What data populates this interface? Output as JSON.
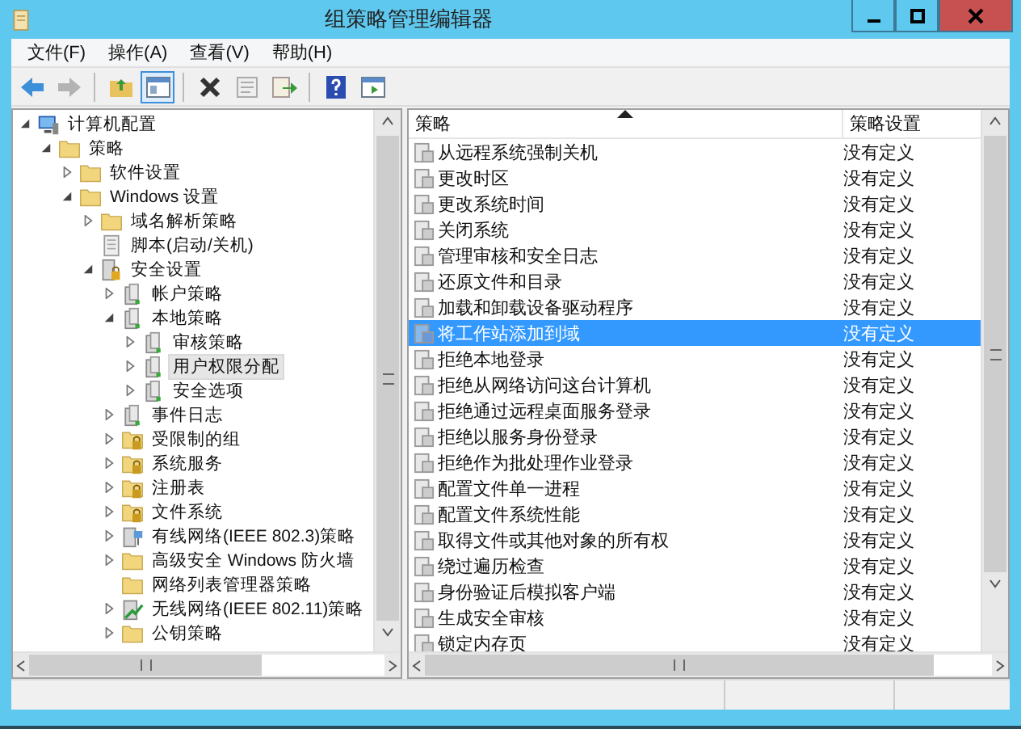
{
  "window": {
    "title": "组策略管理编辑器"
  },
  "menu": [
    "文件(F)",
    "操作(A)",
    "查看(V)",
    "帮助(H)"
  ],
  "toolbar": [
    [
      {
        "kind": "back",
        "disabled": false,
        "pressed": false
      },
      {
        "kind": "forward",
        "disabled": true,
        "pressed": false
      }
    ],
    [
      {
        "kind": "up",
        "disabled": false,
        "pressed": false
      },
      {
        "kind": "tree",
        "disabled": false,
        "pressed": true
      }
    ],
    [
      {
        "kind": "delete",
        "disabled": false,
        "pressed": false
      },
      {
        "kind": "properties",
        "disabled": true,
        "pressed": false
      },
      {
        "kind": "export",
        "disabled": false,
        "pressed": false
      }
    ],
    [
      {
        "kind": "help",
        "disabled": false,
        "pressed": false
      },
      {
        "kind": "pane",
        "disabled": false,
        "pressed": false
      }
    ]
  ],
  "tree": [
    {
      "label": "计算机配置",
      "kind": "computer",
      "expanded": true,
      "selected": false,
      "children": [
        {
          "label": "策略",
          "kind": "folder",
          "expanded": true,
          "selected": false,
          "children": [
            {
              "label": "软件设置",
              "kind": "folder",
              "expanded": false,
              "selected": false
            },
            {
              "label": "Windows 设置",
              "kind": "folder",
              "expanded": true,
              "selected": false,
              "children": [
                {
                  "label": "域名解析策略",
                  "kind": "folder",
                  "expanded": false,
                  "selected": false
                },
                {
                  "label": "脚本(启动/关机)",
                  "kind": "script",
                  "selected": false
                },
                {
                  "label": "安全设置",
                  "kind": "security",
                  "expanded": true,
                  "selected": false,
                  "children": [
                    {
                      "label": "帐户策略",
                      "kind": "policy",
                      "expanded": false,
                      "selected": false
                    },
                    {
                      "label": "本地策略",
                      "kind": "policy",
                      "expanded": true,
                      "selected": false,
                      "children": [
                        {
                          "label": "审核策略",
                          "kind": "policy",
                          "expanded": false,
                          "selected": false
                        },
                        {
                          "label": "用户权限分配",
                          "kind": "policy",
                          "expanded": false,
                          "selected": true
                        },
                        {
                          "label": "安全选项",
                          "kind": "policy",
                          "expanded": false,
                          "selected": false
                        }
                      ]
                    },
                    {
                      "label": "事件日志",
                      "kind": "policy",
                      "expanded": false,
                      "selected": false
                    },
                    {
                      "label": "受限制的组",
                      "kind": "locked-folder",
                      "expanded": false,
                      "selected": false
                    },
                    {
                      "label": "系统服务",
                      "kind": "locked-folder",
                      "expanded": false,
                      "selected": false
                    },
                    {
                      "label": "注册表",
                      "kind": "locked-folder",
                      "expanded": false,
                      "selected": false
                    },
                    {
                      "label": "文件系统",
                      "kind": "locked-folder",
                      "expanded": false,
                      "selected": false
                    },
                    {
                      "label": "有线网络(IEEE 802.3)策略",
                      "kind": "network",
                      "expanded": false,
                      "selected": false
                    },
                    {
                      "label": "高级安全 Windows 防火墙",
                      "kind": "folder",
                      "expanded": false,
                      "selected": false
                    },
                    {
                      "label": "网络列表管理器策略",
                      "kind": "folder",
                      "selected": false
                    },
                    {
                      "label": "无线网络(IEEE 802.11)策略",
                      "kind": "wireless",
                      "expanded": false,
                      "selected": false
                    },
                    {
                      "label": "公钥策略",
                      "kind": "folder",
                      "expanded": false,
                      "selected": false
                    }
                  ]
                }
              ]
            }
          ]
        }
      ]
    }
  ],
  "table": {
    "columns": [
      {
        "label": "策略",
        "sorted": true
      },
      {
        "label": "策略设置",
        "sorted": false
      }
    ],
    "rows": [
      {
        "policy": "从远程系统强制关机",
        "setting": "没有定义",
        "selected": false
      },
      {
        "policy": "更改时区",
        "setting": "没有定义",
        "selected": false
      },
      {
        "policy": "更改系统时间",
        "setting": "没有定义",
        "selected": false
      },
      {
        "policy": "关闭系统",
        "setting": "没有定义",
        "selected": false
      },
      {
        "policy": "管理审核和安全日志",
        "setting": "没有定义",
        "selected": false
      },
      {
        "policy": "还原文件和目录",
        "setting": "没有定义",
        "selected": false
      },
      {
        "policy": "加载和卸载设备驱动程序",
        "setting": "没有定义",
        "selected": false
      },
      {
        "policy": "将工作站添加到域",
        "setting": "没有定义",
        "selected": true
      },
      {
        "policy": "拒绝本地登录",
        "setting": "没有定义",
        "selected": false
      },
      {
        "policy": "拒绝从网络访问这台计算机",
        "setting": "没有定义",
        "selected": false
      },
      {
        "policy": "拒绝通过远程桌面服务登录",
        "setting": "没有定义",
        "selected": false
      },
      {
        "policy": "拒绝以服务身份登录",
        "setting": "没有定义",
        "selected": false
      },
      {
        "policy": "拒绝作为批处理作业登录",
        "setting": "没有定义",
        "selected": false
      },
      {
        "policy": "配置文件单一进程",
        "setting": "没有定义",
        "selected": false
      },
      {
        "policy": "配置文件系统性能",
        "setting": "没有定义",
        "selected": false
      },
      {
        "policy": "取得文件或其他对象的所有权",
        "setting": "没有定义",
        "selected": false
      },
      {
        "policy": "绕过遍历检查",
        "setting": "没有定义",
        "selected": false
      },
      {
        "policy": "身份验证后模拟客户端",
        "setting": "没有定义",
        "selected": false
      },
      {
        "policy": "生成安全审核",
        "setting": "没有定义",
        "selected": false
      },
      {
        "policy": "锁定内存页",
        "setting": "没有定义",
        "selected": false
      }
    ]
  }
}
